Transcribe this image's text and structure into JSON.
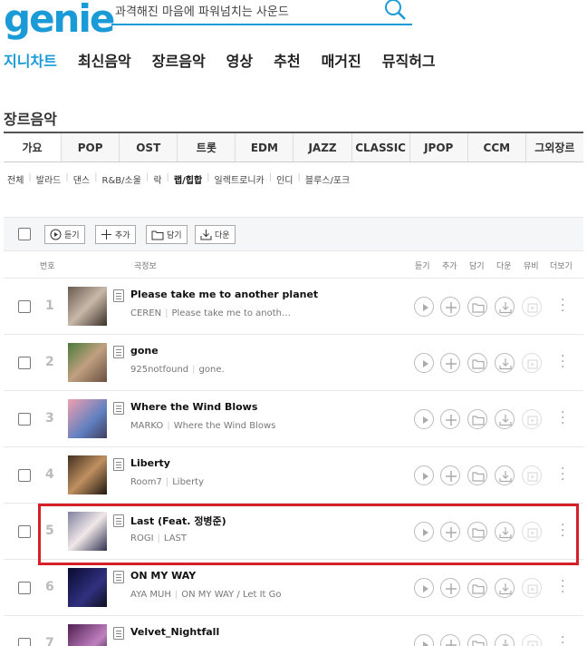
{
  "header": {
    "logo": "genie",
    "search_text": "과격해진 마음에 파워넘치는 사운드"
  },
  "gnb": [
    "지니차트",
    "최신음악",
    "장르음악",
    "영상",
    "추천",
    "매거진",
    "뮤직허그"
  ],
  "section_title": "장르음악",
  "genre_tabs": [
    "가요",
    "POP",
    "OST",
    "트롯",
    "EDM",
    "JAZZ",
    "CLASSIC",
    "JPOP",
    "CCM",
    "그외장르"
  ],
  "sub_genres": [
    "전체",
    "발라드",
    "댄스",
    "R&B/소울",
    "락",
    "랩/힙합",
    "일렉트로니카",
    "인디",
    "블루스/포크"
  ],
  "toolbar": {
    "listen": "듣기",
    "add": "추가",
    "save": "담기",
    "download": "다운"
  },
  "columns": {
    "num": "번호",
    "info": "곡정보",
    "listen": "듣기",
    "add": "추가",
    "save": "담기",
    "download": "다운",
    "video": "뮤비",
    "more": "더보기"
  },
  "songs": [
    {
      "num": "1",
      "title": "Please take me to another planet",
      "artist": "CEREN",
      "album": "Please take me to anoth…"
    },
    {
      "num": "2",
      "title": "gone",
      "artist": "925notfound",
      "album": "gone."
    },
    {
      "num": "3",
      "title": "Where the Wind Blows",
      "artist": "MARKO",
      "album": "Where the Wind Blows"
    },
    {
      "num": "4",
      "title": "Liberty",
      "artist": "Room7",
      "album": "Liberty"
    },
    {
      "num": "5",
      "title": "Last (Feat. 정병준)",
      "artist": "ROGI",
      "album": "LAST"
    },
    {
      "num": "6",
      "title": "ON MY WAY",
      "artist": "AYA MUH",
      "album": "ON MY WAY / Let It Go"
    },
    {
      "num": "7",
      "title": "Velvet_Nightfall",
      "artist": "",
      "album": ""
    }
  ],
  "colors": {
    "brand": "#1a9bd7",
    "highlight": "#d62028"
  }
}
